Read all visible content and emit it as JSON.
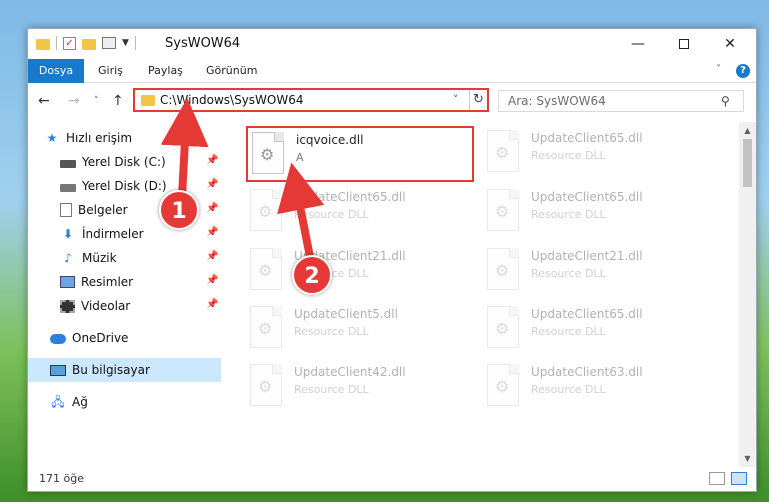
{
  "window": {
    "title": "SysWOW64",
    "min_icon": "minimize-icon",
    "max_icon": "maximize-icon",
    "close_glyph": "✕"
  },
  "ribbon": {
    "tabs": [
      {
        "label": "Dosya",
        "active": true
      },
      {
        "label": "Giriş"
      },
      {
        "label": "Paylaş"
      },
      {
        "label": "Görünüm"
      }
    ]
  },
  "nav": {
    "back_glyph": "←",
    "forward_glyph": "→",
    "recent_glyph": "˅",
    "up_glyph": "↑",
    "address": "C:\\Windows\\SysWOW64",
    "address_drop_glyph": "˅",
    "refresh_glyph": "↻",
    "search_placeholder": "Ara: SysWOW64",
    "search_glyph": "⚲"
  },
  "sidebar": {
    "items": [
      {
        "label": "Hızlı erişim",
        "icon": "star-icon"
      },
      {
        "label": "Yerel Disk (C:)",
        "icon": "disk-icon",
        "pinned": true
      },
      {
        "label": "Yerel Disk (D:)",
        "icon": "disk-icon",
        "pinned": true
      },
      {
        "label": "Belgeler",
        "icon": "documents-icon",
        "pinned": true
      },
      {
        "label": "İndirmeler",
        "icon": "downloads-icon",
        "pinned": true
      },
      {
        "label": "Müzik",
        "icon": "music-icon",
        "pinned": true
      },
      {
        "label": "Resimler",
        "icon": "pictures-icon",
        "pinned": true
      },
      {
        "label": "Videolar",
        "icon": "videos-icon",
        "pinned": true
      },
      {
        "label": "OneDrive",
        "icon": "onedrive-icon"
      },
      {
        "label": "Bu bilgisayar",
        "icon": "pc-icon",
        "selected": true
      },
      {
        "label": "Ağ",
        "icon": "network-icon"
      }
    ]
  },
  "files": [
    {
      "name": "icqvoice.dll",
      "sub": "A",
      "selected": true
    },
    {
      "name": "UpdateClient65.dll",
      "sub": "Resource DLL"
    },
    {
      "name": "UpdateClient65.dll",
      "sub": "Resource DLL"
    },
    {
      "name": "UpdateClient65.dll",
      "sub": "Resource DLL"
    },
    {
      "name": "UpdateClient21.dll",
      "sub": "Resource DLL"
    },
    {
      "name": "UpdateClient21.dll",
      "sub": "Resource DLL"
    },
    {
      "name": "UpdateClient5.dll",
      "sub": "Resource DLL"
    },
    {
      "name": "UpdateClient65.dll",
      "sub": "Resource DLL"
    },
    {
      "name": "UpdateClient42.dll",
      "sub": "Resource DLL"
    },
    {
      "name": "UpdateClient63.dll",
      "sub": "Resource DLL"
    }
  ],
  "status": {
    "count": "171 öğe"
  },
  "annotations": {
    "badge1": "1",
    "badge2": "2",
    "color": "#e53935"
  }
}
